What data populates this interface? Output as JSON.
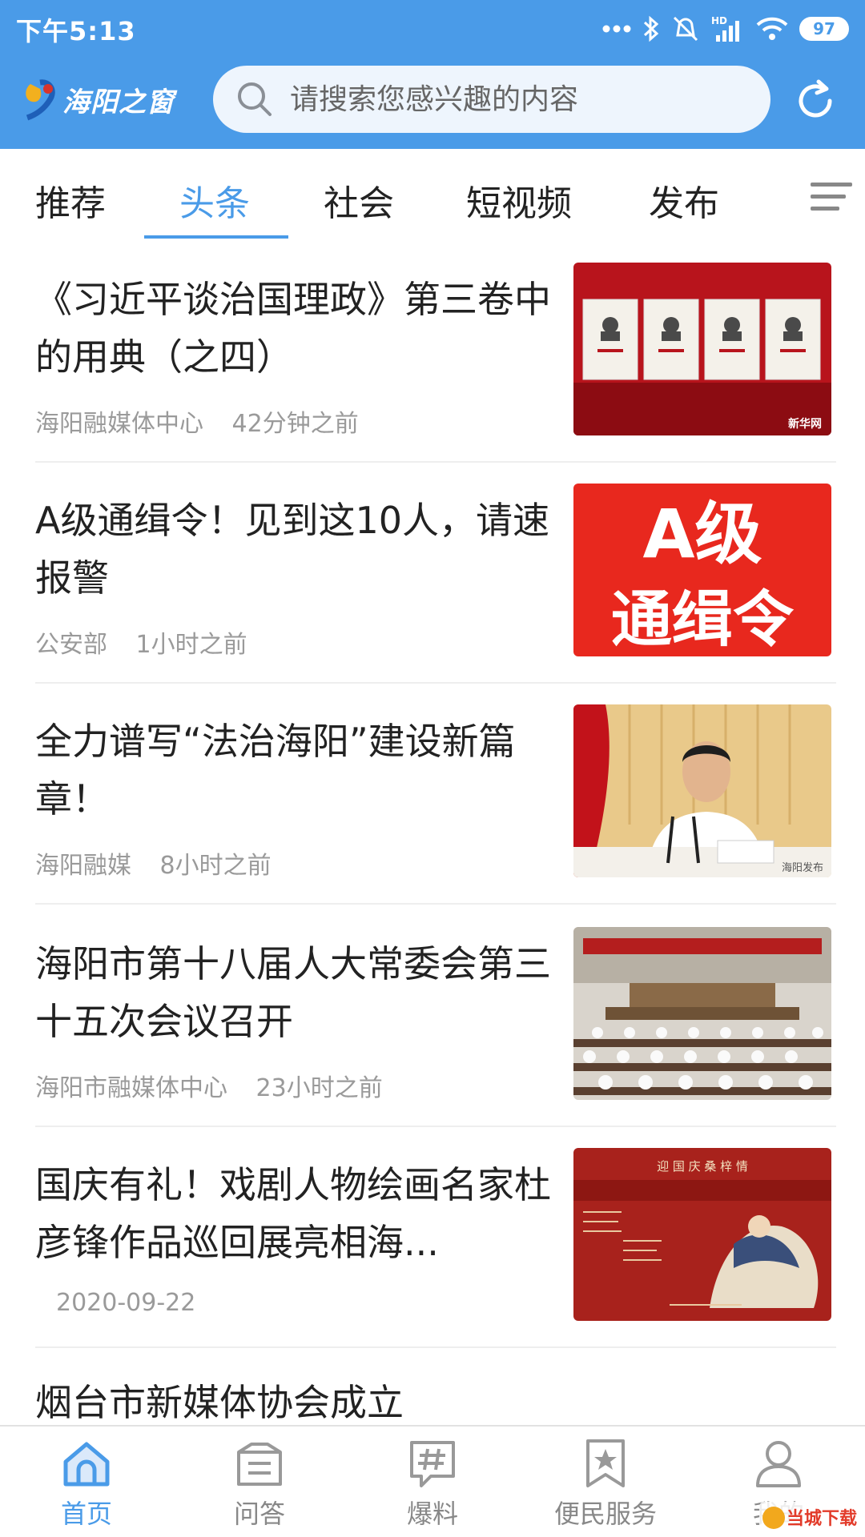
{
  "status_bar": {
    "time": "下午5:13",
    "battery": "97"
  },
  "header": {
    "app_name": "海阳之窗",
    "search_placeholder": "请搜索您感兴趣的内容",
    "accent": "#4a9be8"
  },
  "tabs": [
    {
      "label": "推荐",
      "active": false
    },
    {
      "label": "头条",
      "active": true
    },
    {
      "label": "社会",
      "active": false
    },
    {
      "label": "短视频",
      "active": false
    },
    {
      "label": "发布",
      "active": false
    }
  ],
  "news": [
    {
      "title": "《习近平谈治国理政》第三卷中的用典（之四）",
      "source": "海阳融媒体中心",
      "time": "42分钟之前",
      "thumb_text": "新华网"
    },
    {
      "title": "A级通缉令！见到这10人，请速报警",
      "source": "公安部",
      "time": "1小时之前",
      "thumb_line1": "A级",
      "thumb_line2": "通缉令"
    },
    {
      "title": "全力谱写“法治海阳”建设新篇章！",
      "source": "海阳融媒",
      "time": "8小时之前",
      "thumb_text": "海阳发布"
    },
    {
      "title": "海阳市第十八届人大常委会第三十五次会议召开",
      "source": "海阳市融媒体中心",
      "time": "23小时之前"
    },
    {
      "title": "国庆有礼！戏剧人物绘画名家杜彦锋作品巡回展亮相海...",
      "date": "2020-09-22",
      "thumb_text": "迎 国 庆    桑 梓 情"
    },
    {
      "title": "烟台市新媒体协会成立"
    }
  ],
  "bottom_nav": [
    {
      "label": "首页",
      "icon": "home-icon",
      "active": true
    },
    {
      "label": "问答",
      "icon": "qa-icon",
      "active": false
    },
    {
      "label": "爆料",
      "icon": "hashtag-icon",
      "active": false
    },
    {
      "label": "便民服务",
      "icon": "star-bookmark-icon",
      "active": false
    },
    {
      "label": "我的",
      "icon": "user-icon",
      "active": false
    }
  ],
  "watermark": "当城下载"
}
